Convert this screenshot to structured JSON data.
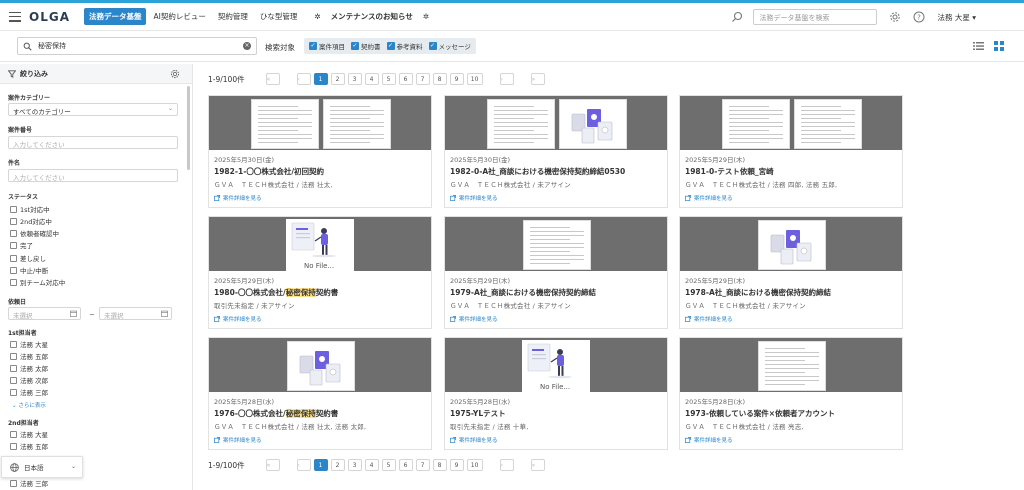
{
  "header": {
    "logo": "OLGA",
    "nav": [
      {
        "label": "法務データ基盤",
        "active": true
      },
      {
        "label": "AI契約レビュー"
      },
      {
        "label": "契約管理"
      },
      {
        "label": "ひな型管理"
      },
      {
        "label": "メンテナンスのお知らせ",
        "notice": true
      }
    ],
    "search_placeholder": "法務データ基盤を検索",
    "user": "法務 大星"
  },
  "search": {
    "value": "秘密保持",
    "target_label": "検索対象",
    "targets": [
      "案件項目",
      "契約書",
      "参考資料",
      "メッセージ"
    ]
  },
  "sidebar": {
    "title": "絞り込み",
    "category": {
      "label": "案件カテゴリー",
      "value": "すべてのカテゴリー"
    },
    "case_number": {
      "label": "案件番号",
      "placeholder": "入力してください"
    },
    "subject": {
      "label": "件名",
      "placeholder": "入力してください"
    },
    "status": {
      "label": "ステータス",
      "options": [
        "1st対応中",
        "2nd対応中",
        "依頼者確認中",
        "完了",
        "差し戻し",
        "中止/中断",
        "別チーム対応中"
      ]
    },
    "request_date": {
      "label": "依頼日",
      "from_placeholder": "未選択",
      "to_placeholder": "未選択"
    },
    "first_assignee": {
      "label": "1st担当者",
      "options": [
        "法務 大星",
        "法務 五郎",
        "法務 太郎",
        "法務 次郎",
        "法務 三郎"
      ],
      "more": "さらに表示"
    },
    "second_assignee": {
      "label": "2nd担当者",
      "options": [
        "法務 大星",
        "法務 五郎",
        "法務 三郎"
      ]
    },
    "language": "日本語"
  },
  "pagination": {
    "count": "1-9/100件",
    "pages": [
      "1",
      "2",
      "3",
      "4",
      "5",
      "6",
      "7",
      "8",
      "9",
      "10"
    ],
    "current": "1",
    "first": "«",
    "prev": "‹",
    "next": "›",
    "last": "»"
  },
  "cards": [
    {
      "date": "2025年5月30日(金)",
      "title_pre": "1982-1-〇〇株式会社/初回契約",
      "highlight": "",
      "title_post": "",
      "sub": "ＧＶＡ　ＴＥＣＨ株式会社 / 法務 壮太,",
      "link": "案件詳細を見る",
      "thumb": "doc-doc"
    },
    {
      "date": "2025年5月30日(金)",
      "title_pre": "1982-0-A社_商談における機密保持契約締結0530",
      "highlight": "",
      "title_post": "",
      "sub": "ＧＶＡ　ＴＥＣＨ株式会社 / 未アサイン",
      "link": "案件詳細を見る",
      "thumb": "doc-tiles"
    },
    {
      "date": "2025年5月29日(木)",
      "title_pre": "1981-0-テスト依頼_宮崎",
      "highlight": "",
      "title_post": "",
      "sub": "ＧＶＡ　ＴＥＣＨ株式会社 / 法務 四郎, 法務 五郎,",
      "link": "案件詳細を見る",
      "thumb": "doc-doc"
    },
    {
      "date": "2025年5月29日(木)",
      "title_pre": "1980-〇〇株式会社/",
      "highlight": "秘密保持",
      "title_post": "契約書",
      "sub": "取引先未指定 / 未アサイン",
      "link": "案件詳細を見る",
      "thumb": "nofile",
      "nofile": "No File..."
    },
    {
      "date": "2025年5月29日(木)",
      "title_pre": "1979-A社_商談における機密保持契約締結",
      "highlight": "",
      "title_post": "",
      "sub": "ＧＶＡ　ＴＥＣＨ株式会社 / 未アサイン",
      "link": "案件詳細を見る",
      "thumb": "single"
    },
    {
      "date": "2025年5月29日(木)",
      "title_pre": "1978-A社_商談における機密保持契約締結",
      "highlight": "",
      "title_post": "",
      "sub": "ＧＶＡ　ＴＥＣＨ株式会社 / 未アサイン",
      "link": "案件詳細を見る",
      "thumb": "tiles"
    },
    {
      "date": "2025年5月28日(水)",
      "title_pre": "1976-〇〇株式会社/",
      "highlight": "秘密保持",
      "title_post": "契約書",
      "sub": "ＧＶＡ　ＴＥＣＨ株式会社 / 法務 壮太, 法務 太郎,",
      "link": "案件詳細を見る",
      "thumb": "tiles"
    },
    {
      "date": "2025年5月28日(水)",
      "title_pre": "1975-YLテスト",
      "highlight": "",
      "title_post": "",
      "sub": "取引先未指定 / 法務 十華,",
      "link": "案件詳細を見る",
      "thumb": "nofile",
      "nofile": "No File..."
    },
    {
      "date": "2025年5月28日(水)",
      "title_pre": "1973-依頼している案件×依頼者アカウント",
      "highlight": "",
      "title_post": "",
      "sub": "ＧＶＡ　ＴＥＣＨ株式会社 / 法務 亮志,",
      "link": "案件詳細を見る",
      "thumb": "single"
    }
  ],
  "colors": {
    "accent": "#2b86c9",
    "highlight": "#ffe38a",
    "thumb_bg": "#6e6e6e",
    "top_line": "#2ba3d8"
  }
}
